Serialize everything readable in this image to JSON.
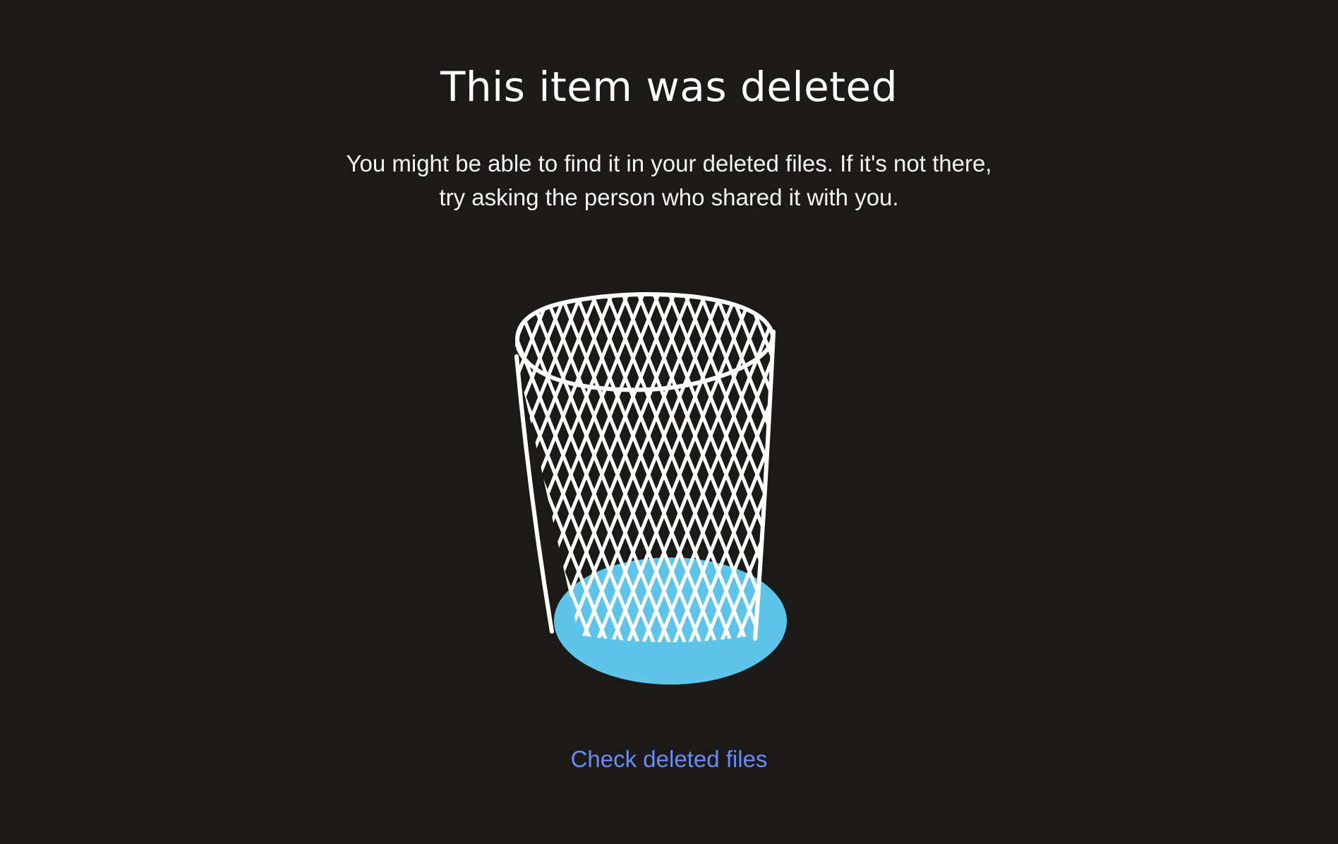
{
  "page": {
    "title": "This item was deleted",
    "message_line1": "You might be able to find it in your deleted files. If it's not there,",
    "message_line2": "try asking the person who shared it with you.",
    "link_label": "Check deleted files"
  },
  "illustration": {
    "icon": "wastebasket-icon",
    "accent_color": "#5ec4ea",
    "stroke_color": "#ffffff"
  },
  "colors": {
    "background": "#1b1a19",
    "text": "#ffffff",
    "link": "#6b8cf7"
  }
}
